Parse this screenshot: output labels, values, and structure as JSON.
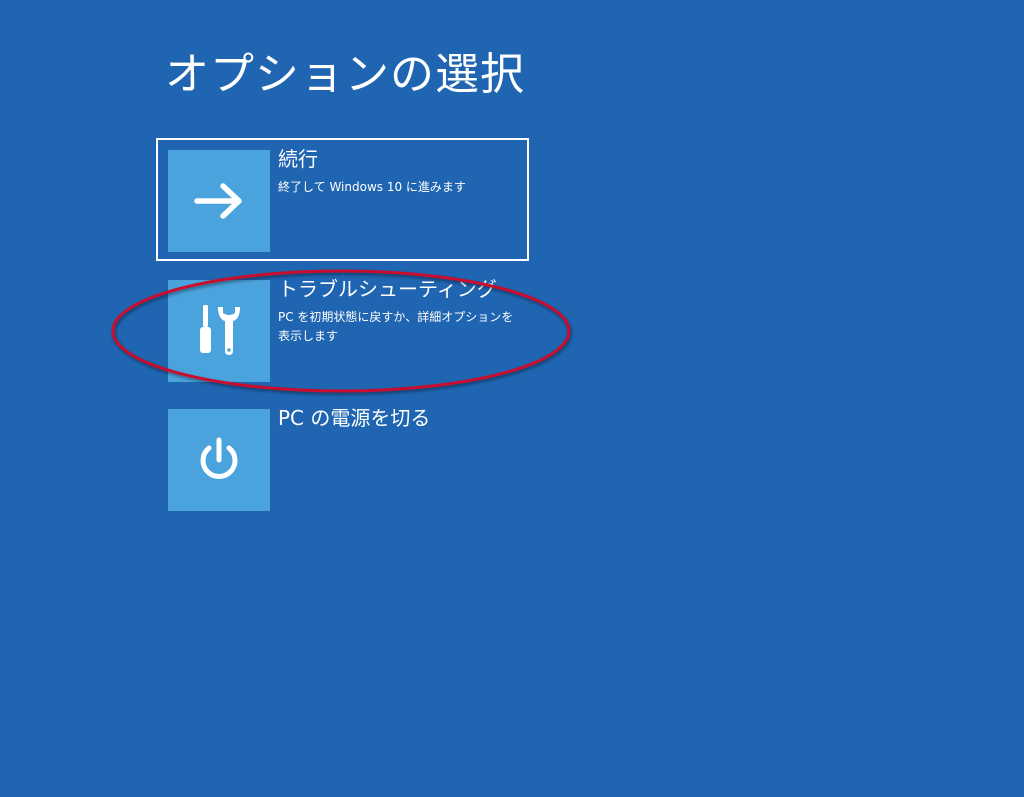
{
  "page": {
    "title": "オプションの選択"
  },
  "options": [
    {
      "icon": "arrow-right-icon",
      "title": "続行",
      "description": "終了して Windows 10 に進みます",
      "selected": true
    },
    {
      "icon": "troubleshoot-tools-icon",
      "title": "トラブルシューティング",
      "description": "PC を初期状態に戻すか、詳細オプションを表示します",
      "selected": false
    },
    {
      "icon": "power-icon",
      "title": "PC の電源を切る",
      "description": "",
      "selected": false
    }
  ],
  "colors": {
    "background": "#1f65b1",
    "icon_tile": "#4aa3dd",
    "annotation": "#c8102e"
  }
}
